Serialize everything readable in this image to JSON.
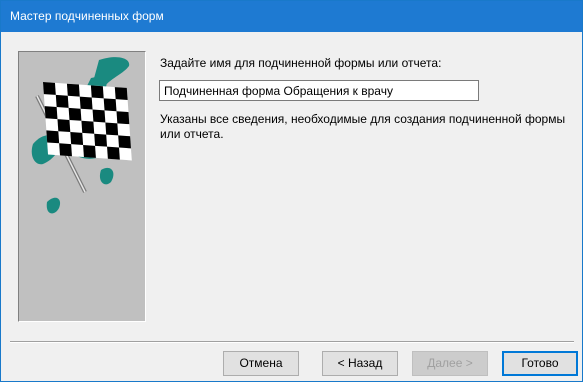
{
  "window": {
    "title": "Мастер подчиненных форм"
  },
  "picture": {
    "icon": "checkered-flag-illustration"
  },
  "form": {
    "prompt": "Задайте имя для подчиненной формы или отчета:",
    "name_value": "Подчиненная форма Обращения к врачу",
    "info_text": "Указаны все сведения, необходимые для создания подчиненной формы или отчета."
  },
  "buttons": {
    "cancel": "Отмена",
    "back": "< Назад",
    "next": "Далее >",
    "finish": "Готово"
  },
  "colors": {
    "titlebar": "#1e7ad2",
    "teal": "#1a8a80",
    "panel": "#c0c0c0"
  }
}
